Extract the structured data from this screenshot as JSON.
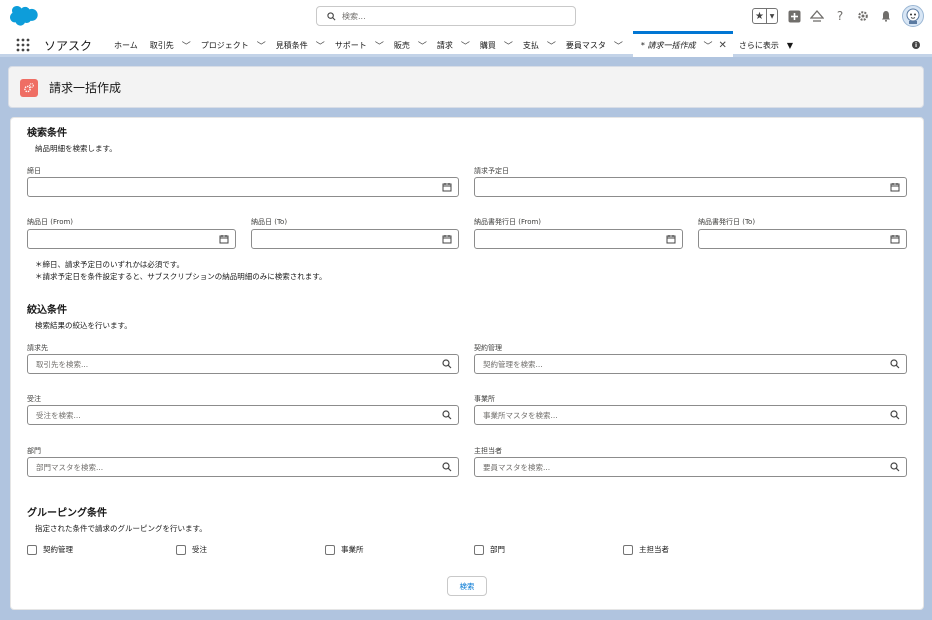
{
  "header": {
    "search_placeholder": "検索..."
  },
  "nav": {
    "app_name": "ソアスク",
    "items": [
      {
        "label": "ホーム",
        "has_menu": false
      },
      {
        "label": "取引先",
        "has_menu": true
      },
      {
        "label": "プロジェクト",
        "has_menu": true
      },
      {
        "label": "見積条件",
        "has_menu": true
      },
      {
        "label": "サポート",
        "has_menu": true
      },
      {
        "label": "販売",
        "has_menu": true
      },
      {
        "label": "請求",
        "has_menu": true
      },
      {
        "label": "購買",
        "has_menu": true
      },
      {
        "label": "支払",
        "has_menu": true
      },
      {
        "label": "要員マスタ",
        "has_menu": true
      }
    ],
    "active_tab": "* 請求一括作成",
    "more_label": "さらに表示"
  },
  "page": {
    "title": "請求一括作成"
  },
  "search_section": {
    "title": "検索条件",
    "description": "納品明細を検索します。",
    "fields": {
      "shime_bi": {
        "label": "締日",
        "value": ""
      },
      "seikyu_yotei_bi": {
        "label": "請求予定日",
        "value": ""
      },
      "nouhin_from": {
        "label": "納品日 (From)",
        "value": ""
      },
      "nouhin_to": {
        "label": "納品日 (To)",
        "value": ""
      },
      "nouhinsho_from": {
        "label": "納品書発行日 (From)",
        "value": ""
      },
      "nouhinsho_to": {
        "label": "納品書発行日 (To)",
        "value": ""
      }
    },
    "notes": [
      "＊締日、請求予定日のいずれかは必須です。",
      "＊請求予定日を条件設定すると、サブスクリプションの納品明細のみに検索されます。"
    ]
  },
  "filter_section": {
    "title": "絞込条件",
    "description": "検索結果の絞込を行います。",
    "fields": {
      "seikyusaki": {
        "label": "請求先",
        "placeholder": "取引先を検索..."
      },
      "keiyaku_kanri": {
        "label": "契約管理",
        "placeholder": "契約管理を検索..."
      },
      "juchu": {
        "label": "受注",
        "placeholder": "受注を検索..."
      },
      "jigyosho": {
        "label": "事業所",
        "placeholder": "事業所マスタを検索..."
      },
      "bumon": {
        "label": "部門",
        "placeholder": "部門マスタを検索..."
      },
      "shutantousha": {
        "label": "主担当者",
        "placeholder": "要員マスタを検索..."
      }
    }
  },
  "grouping_section": {
    "title": "グルーピング条件",
    "description": "指定された条件で請求のグルーピングを行います。",
    "options": [
      {
        "label": "契約管理",
        "checked": false
      },
      {
        "label": "受注",
        "checked": false
      },
      {
        "label": "事業所",
        "checked": false
      },
      {
        "label": "部門",
        "checked": false
      },
      {
        "label": "主担当者",
        "checked": false
      }
    ]
  },
  "actions": {
    "search_button": "検索"
  },
  "colors": {
    "brand_blue": "#0176d3",
    "page_icon": "#ef6e64",
    "background": "#b0c4df"
  }
}
